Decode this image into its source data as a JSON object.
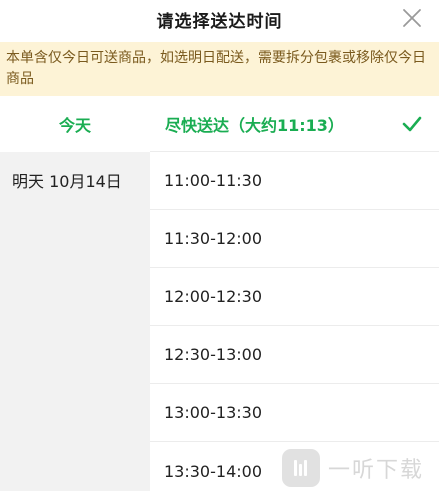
{
  "header": {
    "title": "请选择送达时间",
    "close_icon": "close-icon"
  },
  "notice": {
    "text": "本单含仅今日可送商品，如选明日配送，需要拆分包裹或移除仅今日商品"
  },
  "days": {
    "today": "今天",
    "tomorrow": "明天 10月14日"
  },
  "asap": {
    "label": "尽快送达（大约11:13）",
    "selected": true,
    "check_icon": "check-icon"
  },
  "slots": [
    "11:00-11:30",
    "11:30-12:00",
    "12:00-12:30",
    "12:30-13:00",
    "13:00-13:30",
    "13:30-14:00"
  ],
  "watermark": {
    "text": "一听下载"
  },
  "colors": {
    "accent": "#1aad52",
    "notice_bg": "#fdf3d6",
    "notice_text": "#7a5a1e",
    "left_col_bg": "#f2f2f2"
  }
}
